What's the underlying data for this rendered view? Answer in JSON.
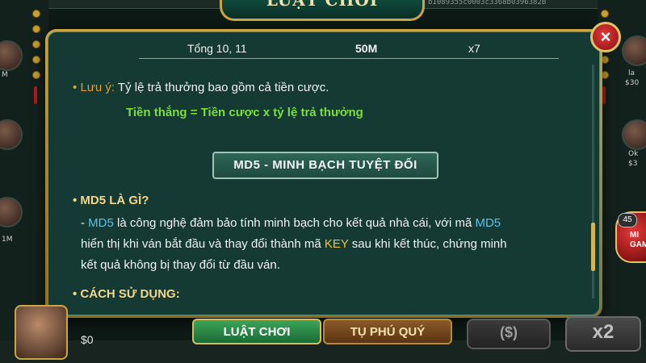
{
  "dialog": {
    "title": "LUẬT CHƠI",
    "close_label": "×"
  },
  "top_hash_text": "b1089355c0003c3368b0396382B",
  "payout_row": {
    "label": "Tổng 10, 11",
    "amount": "50M",
    "multiplier": "x7"
  },
  "note": {
    "bullet": "•",
    "prefix": "Lưu ý:",
    "text": "Tỷ lệ trả thưởng bao gồm cả tiền cược.",
    "formula": "Tiền thắng = Tiền cược x tỷ lệ trả thưởng"
  },
  "md5_button": "MD5 - MINH BẠCH TUYỆT ĐỐI",
  "md5_section": {
    "heading": "• MD5 LÀ GÌ?",
    "line1_a": "- ",
    "line1_hl": "MD5",
    "line1_b": " là công nghệ đảm bảo tính minh bạch cho kết quả nhà cái, với mã ",
    "line1_hl2": "MD5",
    "line2_a": "hiển thị khi ván bắt đầu và thay đổi thành mã ",
    "line2_hl": "KEY",
    "line2_b": " sau khi kết thúc, chứng minh",
    "line3": "kết quả không bị thay đổi từ đầu ván."
  },
  "usage_heading": "• CÁCH SỬ DỤNG:",
  "tabs": [
    {
      "label": "LUẬT CHƠI",
      "active": true
    },
    {
      "label": "TỤ PHÚ QUÝ",
      "active": false
    }
  ],
  "player": {
    "money": "$0"
  },
  "bottom_buttons": {
    "dollar_label": "($)",
    "x2_label": "x2"
  },
  "mini_game": {
    "badge": "45",
    "label": "MI GAM"
  },
  "side_players": [
    {
      "name": "la",
      "value": "M"
    },
    {
      "name": "la",
      "value": "$30"
    },
    {
      "name": "Ok",
      "value": "$3"
    },
    {
      "name": "1",
      "value": "1M"
    }
  ],
  "colors": {
    "panel_bg": "#143a33",
    "gold_border": "#c9a544",
    "active_tab": "#2f8c48",
    "formula_green": "#7cde3c",
    "highlight_blue": "#5fc2e8",
    "highlight_yellow": "#f0c23a"
  }
}
